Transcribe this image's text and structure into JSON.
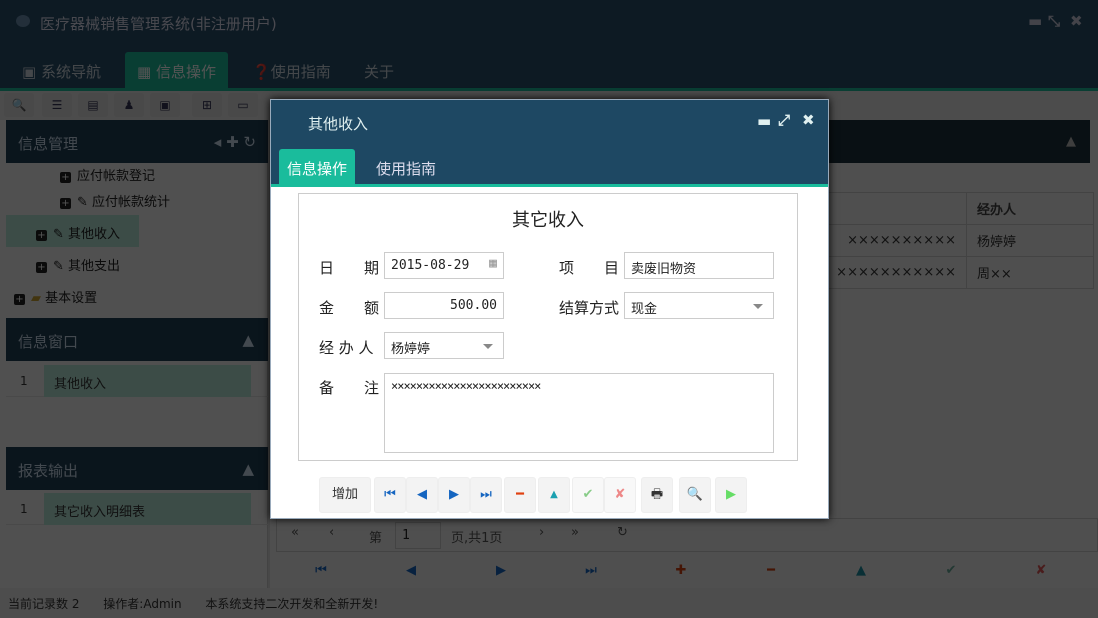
{
  "app": {
    "title": "医疗器械销售管理系统(非注册用户)",
    "nav_tabs": [
      "系统导航",
      "信息操作",
      "使用指南",
      "关于"
    ]
  },
  "sidebar": {
    "panel1_title": "信息管理",
    "tree": [
      "应付帐款登记",
      "应付帐款统计",
      "其他收入",
      "其他支出",
      "基本设置"
    ],
    "panel2_title": "信息窗口",
    "window_rows": [
      {
        "n": "1",
        "v": "其他收入"
      }
    ],
    "panel3_title": "报表输出",
    "report_rows": [
      {
        "n": "1",
        "v": "其它收入明细表"
      }
    ]
  },
  "grid": {
    "header_last": "经办人",
    "rows": [
      {
        "note": "××××××××××",
        "handler": "杨婷婷"
      },
      {
        "note": "×××××××××××",
        "handler": "周××"
      }
    ]
  },
  "pager": {
    "page_prefix": "第",
    "page": "1",
    "page_suffix": "页,共1页"
  },
  "status": {
    "records": "当前记录数 2",
    "operator": "操作者:Admin",
    "msg": "本系统支持二次开发和全新开发!"
  },
  "dialog": {
    "title": "其他收入",
    "tabs": [
      "信息操作",
      "使用指南"
    ],
    "form_title": "其它收入",
    "labels": {
      "date": "日　　期",
      "item": "项　　目",
      "amount": "金　　额",
      "settle": "结算方式",
      "handler": "经 办 人",
      "note": "备　　注"
    },
    "values": {
      "date": "2015-08-29",
      "item": "卖废旧物资",
      "amount": "500.00",
      "settle": "现金",
      "handler": "杨婷婷",
      "note": "××××××××××××××××××××××××"
    },
    "add_button": "增加"
  }
}
